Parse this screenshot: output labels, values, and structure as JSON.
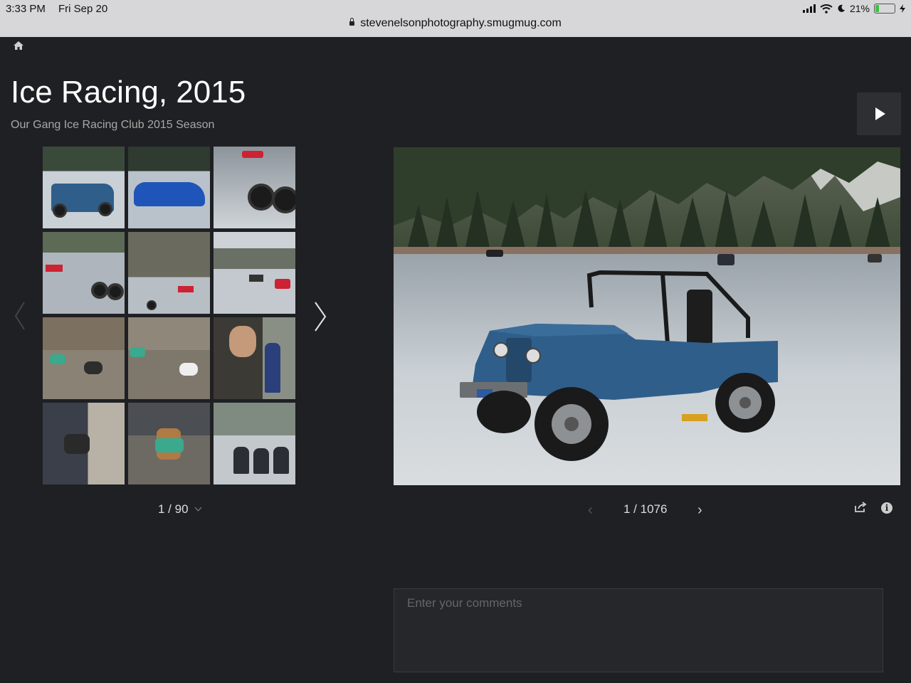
{
  "status_bar": {
    "time": "3:33 PM",
    "date": "Fri Sep 20",
    "battery": "21%",
    "battery_level": 0.21,
    "url": "stevenelsonphotography.smugmug.com"
  },
  "gallery": {
    "title": "Ice Racing, 2015",
    "subtitle": "Our Gang Ice Racing Club 2015 Season",
    "thumb_counter": "1 / 90",
    "photo_counter": "1 / 1076"
  },
  "comments": {
    "placeholder": "Enter your comments"
  },
  "icons": {
    "home": "home-icon",
    "play": "play-icon",
    "share": "share-icon",
    "info": "info-icon"
  },
  "colors": {
    "background": "#1f2023",
    "status_bar": "#d7d7d9",
    "jeep_blue": "#2f5e8a",
    "battery_green": "#39c53c"
  }
}
